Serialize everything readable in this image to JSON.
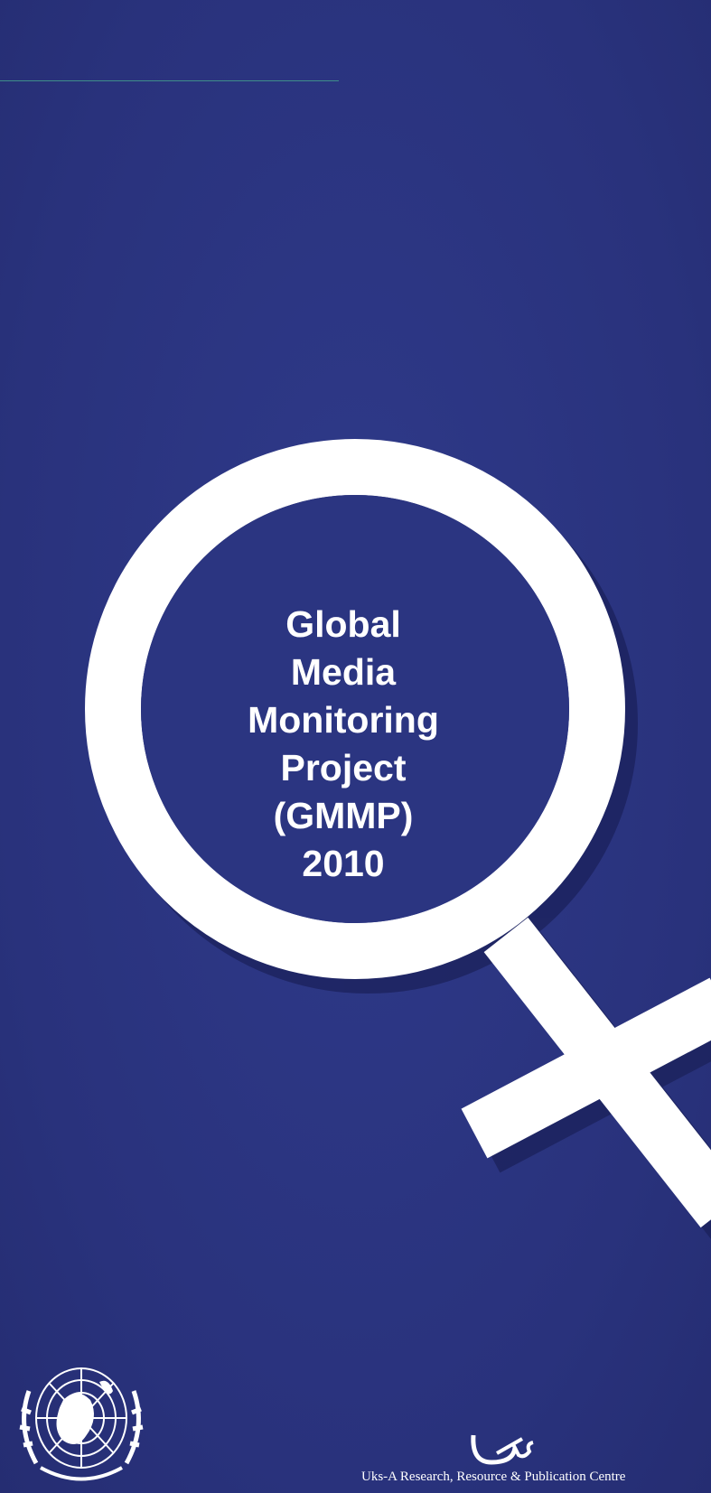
{
  "cover": {
    "title_lines": [
      "Global",
      "Media",
      "Monitoring",
      "Project",
      "(GMMP)",
      "2010"
    ],
    "background_color": "#2b3581",
    "symbol": "female-venus-icon"
  },
  "footer": {
    "left_logo": "un-emblem-icon",
    "right_logo_text": "Uks",
    "organization": "Uks-A Research, Resource & Publication Centre"
  }
}
